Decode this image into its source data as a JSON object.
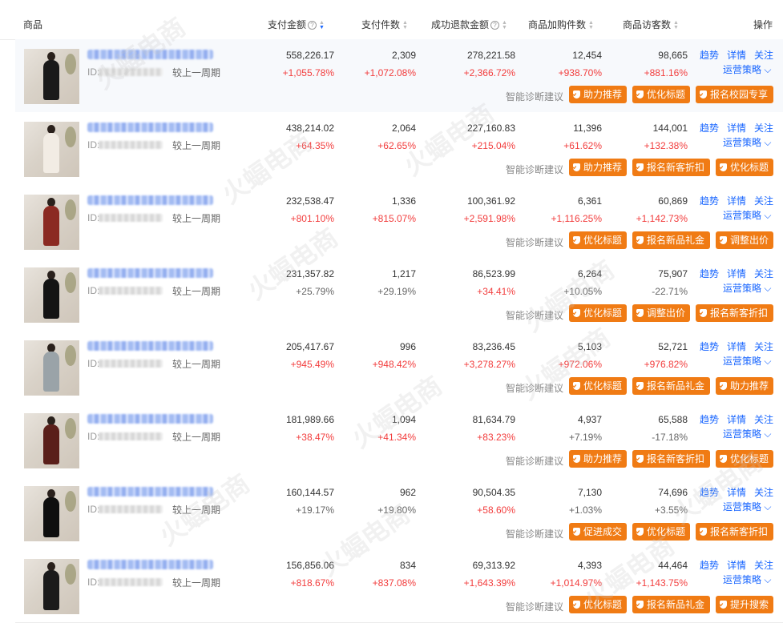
{
  "header": {
    "product": "商品",
    "pay_amount": "支付金额",
    "pay_count": "支付件数",
    "refund": "成功退款金额",
    "cart": "商品加购件数",
    "visitors": "商品访客数",
    "ops": "操作"
  },
  "labels": {
    "id_prefix": "ID:",
    "compare": "较上一周期",
    "trend": "趋势",
    "detail": "详情",
    "follow": "关注",
    "strategy": "运营策略",
    "diagnosis": "智能诊断建议"
  },
  "watermark": "火蝠电商",
  "rows": [
    {
      "pay": "558,226.17",
      "pay_pct": "+1,055.78%",
      "pay_pct_c": "red",
      "cnt": "2,309",
      "cnt_pct": "+1,072.08%",
      "cnt_pct_c": "red",
      "refund": "278,221.58",
      "refund_pct": "+2,366.72%",
      "refund_pct_c": "red",
      "cart": "12,454",
      "cart_pct": "+938.70%",
      "cart_pct_c": "red",
      "vis": "98,665",
      "vis_pct": "+881.16%",
      "vis_pct_c": "red",
      "tags": [
        "助力推荐",
        "优化标题",
        "报名校园专享"
      ],
      "dress": "#1a1a1a"
    },
    {
      "pay": "438,214.02",
      "pay_pct": "+64.35%",
      "pay_pct_c": "red",
      "cnt": "2,064",
      "cnt_pct": "+62.65%",
      "cnt_pct_c": "red",
      "refund": "227,160.83",
      "refund_pct": "+215.04%",
      "refund_pct_c": "red",
      "cart": "11,396",
      "cart_pct": "+61.62%",
      "cart_pct_c": "red",
      "vis": "144,001",
      "vis_pct": "+132.38%",
      "vis_pct_c": "red",
      "tags": [
        "助力推荐",
        "报名新客折扣",
        "优化标题"
      ],
      "dress": "#f2ece4"
    },
    {
      "pay": "232,538.47",
      "pay_pct": "+801.10%",
      "pay_pct_c": "red",
      "cnt": "1,336",
      "cnt_pct": "+815.07%",
      "cnt_pct_c": "red",
      "refund": "100,361.92",
      "refund_pct": "+2,591.98%",
      "refund_pct_c": "red",
      "cart": "6,361",
      "cart_pct": "+1,116.25%",
      "cart_pct_c": "red",
      "vis": "60,869",
      "vis_pct": "+1,142.73%",
      "vis_pct_c": "red",
      "tags": [
        "优化标题",
        "报名新品礼金",
        "调整出价"
      ],
      "dress": "#8b2a22"
    },
    {
      "pay": "231,357.82",
      "pay_pct": "+25.79%",
      "pay_pct_c": "gray",
      "cnt": "1,217",
      "cnt_pct": "+29.19%",
      "cnt_pct_c": "gray",
      "refund": "86,523.99",
      "refund_pct": "+34.41%",
      "refund_pct_c": "red",
      "cart": "6,264",
      "cart_pct": "+10.05%",
      "cart_pct_c": "gray",
      "vis": "75,907",
      "vis_pct": "-22.71%",
      "vis_pct_c": "gray",
      "tags": [
        "优化标题",
        "调整出价",
        "报名新客折扣"
      ],
      "dress": "#141414"
    },
    {
      "pay": "205,417.67",
      "pay_pct": "+945.49%",
      "pay_pct_c": "red",
      "cnt": "996",
      "cnt_pct": "+948.42%",
      "cnt_pct_c": "red",
      "refund": "83,236.45",
      "refund_pct": "+3,278.27%",
      "refund_pct_c": "red",
      "cart": "5,103",
      "cart_pct": "+972.06%",
      "cart_pct_c": "red",
      "vis": "52,721",
      "vis_pct": "+976.82%",
      "vis_pct_c": "red",
      "tags": [
        "优化标题",
        "报名新品礼金",
        "助力推荐"
      ],
      "dress": "#9aa3a8"
    },
    {
      "pay": "181,989.66",
      "pay_pct": "+38.47%",
      "pay_pct_c": "red",
      "cnt": "1,094",
      "cnt_pct": "+41.34%",
      "cnt_pct_c": "red",
      "refund": "81,634.79",
      "refund_pct": "+83.23%",
      "refund_pct_c": "red",
      "cart": "4,937",
      "cart_pct": "+7.19%",
      "cart_pct_c": "gray",
      "vis": "65,588",
      "vis_pct": "-17.18%",
      "vis_pct_c": "gray",
      "tags": [
        "助力推荐",
        "报名新客折扣",
        "优化标题"
      ],
      "dress": "#5a1f1a"
    },
    {
      "pay": "160,144.57",
      "pay_pct": "+19.17%",
      "pay_pct_c": "gray",
      "cnt": "962",
      "cnt_pct": "+19.80%",
      "cnt_pct_c": "gray",
      "refund": "90,504.35",
      "refund_pct": "+58.60%",
      "refund_pct_c": "red",
      "cart": "7,130",
      "cart_pct": "+1.03%",
      "cart_pct_c": "gray",
      "vis": "74,696",
      "vis_pct": "+3.55%",
      "vis_pct_c": "gray",
      "tags": [
        "促进成交",
        "优化标题",
        "报名新客折扣"
      ],
      "dress": "#0f0f0f"
    },
    {
      "pay": "156,856.06",
      "pay_pct": "+818.67%",
      "pay_pct_c": "red",
      "cnt": "834",
      "cnt_pct": "+837.08%",
      "cnt_pct_c": "red",
      "refund": "69,313.92",
      "refund_pct": "+1,643.39%",
      "refund_pct_c": "red",
      "cart": "4,393",
      "cart_pct": "+1,014.97%",
      "cart_pct_c": "red",
      "vis": "44,464",
      "vis_pct": "+1,143.75%",
      "vis_pct_c": "red",
      "tags": [
        "优化标题",
        "报名新品礼金",
        "提升搜索"
      ],
      "dress": "#1b1b1b"
    }
  ]
}
